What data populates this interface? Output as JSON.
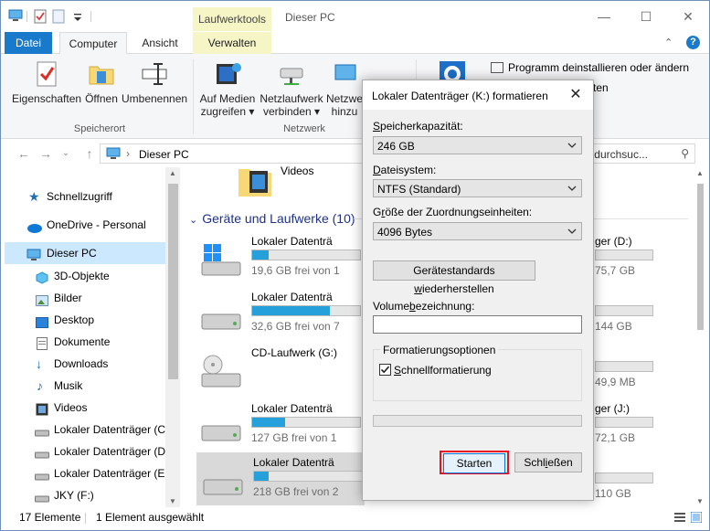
{
  "title_bar": {
    "context_tab": "Laufwerktools",
    "window_title": "Dieser PC"
  },
  "ribbon_tabs": [
    "Datei",
    "Computer",
    "Ansicht",
    "Verwalten"
  ],
  "ribbon": {
    "buttons": {
      "eigenschaften": "Eigenschaften",
      "oeffnen": "Öffnen",
      "umbenennen": "Umbenennen",
      "medien_line1": "Auf Medien",
      "medien_line2": "zugreifen ▾",
      "netzlaufwerk_line1": "Netzlaufwerk",
      "netzlaufwerk_line2": "verbinden ▾",
      "netzwerk_line1": "Netzwe",
      "netzwerk_line2": "hinzu"
    },
    "groups": {
      "speicherort": "Speicherort",
      "netzwerk": "Netzwerk"
    },
    "system": {
      "programm_deinstallieren": "Programm deinstallieren oder ändern",
      "partial": "ten"
    }
  },
  "address_bar": {
    "path": "Dieser PC",
    "search_placeholder": "PC\" durchsuc..."
  },
  "nav_pane": {
    "items": [
      {
        "label": "Schnellzugriff"
      },
      {
        "label": "OneDrive - Personal"
      },
      {
        "label": "Dieser PC"
      },
      {
        "label": "3D-Objekte"
      },
      {
        "label": "Bilder"
      },
      {
        "label": "Desktop"
      },
      {
        "label": "Dokumente"
      },
      {
        "label": "Downloads"
      },
      {
        "label": "Musik"
      },
      {
        "label": "Videos"
      },
      {
        "label": "Lokaler Datenträger (C:"
      },
      {
        "label": "Lokaler Datenträger (D:"
      },
      {
        "label": "Lokaler Datenträger (E:)"
      },
      {
        "label": "JKY (F:)"
      }
    ]
  },
  "content": {
    "videos_label": "Videos",
    "group_header": "Geräte und Laufwerke (10)",
    "drives_left": [
      {
        "name": "Lokaler Datenträ",
        "size": "19,6 GB frei von 1",
        "fill": 0.15
      },
      {
        "name": "Lokaler Datenträ",
        "size": "32,6 GB frei von 7",
        "fill": 0.62
      },
      {
        "name": "CD-Laufwerk (G:)",
        "size": "",
        "fill": 0
      },
      {
        "name": "Lokaler Datenträ",
        "size": "127 GB frei von 1",
        "fill": 0.3
      },
      {
        "name": "Lokaler Datenträ",
        "size": "218 GB frei von 2",
        "fill": 0.12
      }
    ],
    "drives_right": [
      {
        "name": "ger (D:)",
        "size": "75,7 GB",
        "fill": 0.0
      },
      {
        "name": "",
        "size": "144 GB",
        "fill": 0.0
      },
      {
        "name": "",
        "size": "49,9 MB",
        "fill": 0.0
      },
      {
        "name": "ger (J:)",
        "size": "72,1 GB",
        "fill": 0.0
      },
      {
        "name": "",
        "size": "110 GB",
        "fill": 0.0
      }
    ]
  },
  "status_bar": {
    "count": "17 Elemente",
    "selected": "1 Element ausgewählt"
  },
  "dialog": {
    "title": "Lokaler Datenträger (K:) formatieren",
    "capacity_label_u": "S",
    "capacity_label_rest": "peicherkapazität:",
    "capacity_value": "246 GB",
    "filesystem_label_u": "D",
    "filesystem_label_rest": "ateisystem:",
    "filesystem_value": "NTFS (Standard)",
    "alloc_label_a": "G",
    "alloc_label_u": "r",
    "alloc_label_rest": "öße der Zuordnungseinheiten:",
    "alloc_value": "4096 Bytes",
    "restore_a": "Gerätestandards ",
    "restore_u": "w",
    "restore_rest": "iederherstellen",
    "volume_a": "Volume",
    "volume_u": "b",
    "volume_rest": "ezeichnung:",
    "volume_value": "",
    "options_legend": "Formatierungsoptionen",
    "quick_u": "S",
    "quick_rest": "chnellformatierung",
    "quick_checked": true,
    "start_button": "Starten",
    "close_a": "Schl",
    "close_u": "i",
    "close_rest": "eßen"
  },
  "colors": {
    "accent": "#1979ca",
    "drive_fill": "#26a0da",
    "highlight_border": "#e81123"
  }
}
